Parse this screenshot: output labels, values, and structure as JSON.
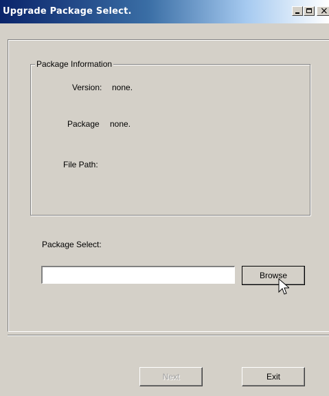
{
  "window": {
    "title": "Upgrade Package Select.",
    "close_glyph": "×"
  },
  "package_info": {
    "legend": "Package Information",
    "version_label": "Version:",
    "version_value": "none.",
    "package_label": "Package",
    "package_value": "none.",
    "file_path_label": "File Path:",
    "file_path_value": ""
  },
  "package_select": {
    "label": "Package Select:",
    "input_value": "",
    "browse_label": "Browse"
  },
  "footer": {
    "next_label": "Next",
    "exit_label": "Exit"
  },
  "icons": {
    "minimize": "minimize-icon",
    "maximize": "maximize-icon",
    "close": "close-icon",
    "cursor": "mouse-pointer-icon"
  }
}
